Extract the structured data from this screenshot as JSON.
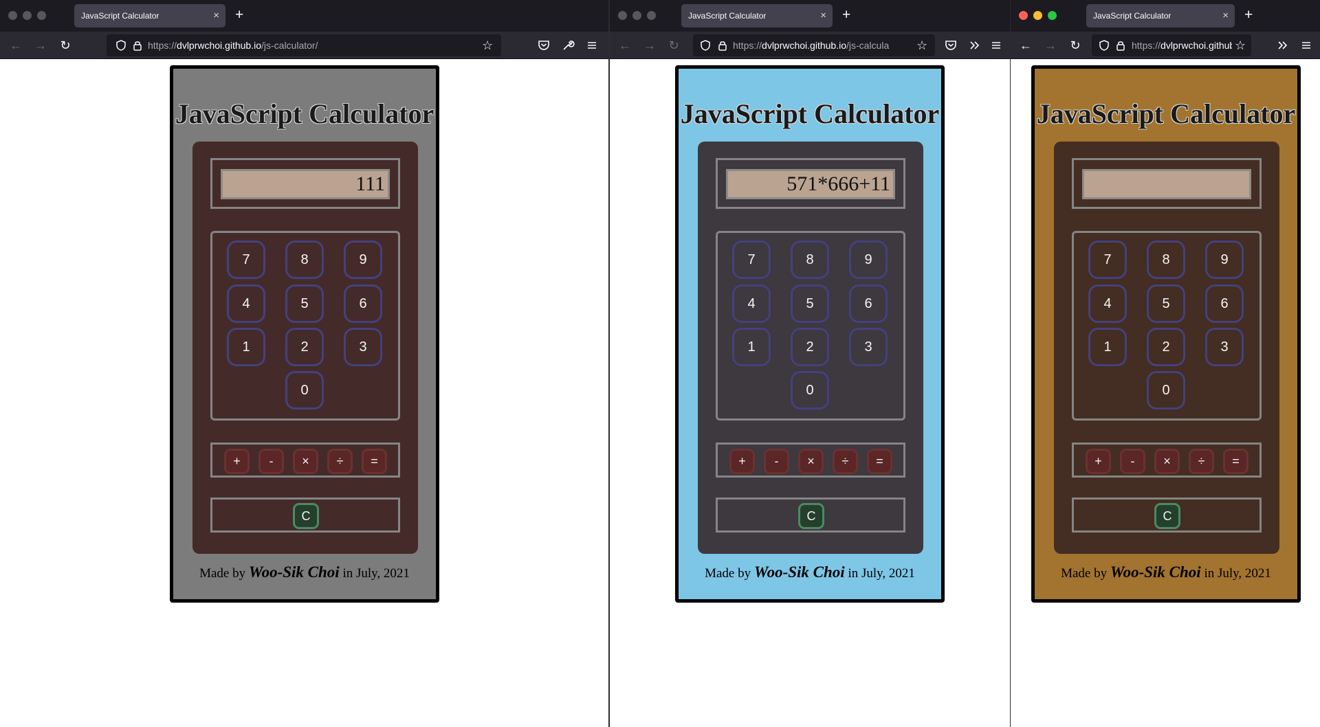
{
  "colors": {
    "titlebar": "#1c1b22",
    "toolbar": "#2b2a33",
    "keypad_border": "#43417e",
    "operator_border": "#6b3131",
    "clear_border": "#4c8a63"
  },
  "windows": [
    {
      "tab_title": "JavaScript Calculator",
      "url_prefix": "https://",
      "url_domain": "dvlprwchoi.github.io",
      "url_path": "/js-calculator/",
      "traffic_lights_active": false,
      "theme": {
        "card_bg": "#7c7c7c",
        "body_bg": "#452a2a"
      },
      "display_value": "111"
    },
    {
      "tab_title": "JavaScript Calculator",
      "url_prefix": "https://",
      "url_domain": "dvlprwchoi.github.io",
      "url_path": "/js-calcula",
      "traffic_lights_active": false,
      "theme": {
        "card_bg": "#7ec6e6",
        "body_bg": "#3e383f"
      },
      "display_value": "571*666+11"
    },
    {
      "tab_title": "JavaScript Calculator",
      "url_prefix": "https://",
      "url_domain": "dvlprwchoi.github",
      "url_path": "",
      "traffic_lights_active": true,
      "theme": {
        "card_bg": "#a3742f",
        "body_bg": "#442d22"
      },
      "display_value": ""
    }
  ],
  "calculator": {
    "title": "JavaScript Calculator",
    "digits": [
      "7",
      "8",
      "9",
      "4",
      "5",
      "6",
      "1",
      "2",
      "3",
      "0"
    ],
    "operators": [
      "+",
      "-",
      "×",
      "÷",
      "="
    ],
    "clear": "C",
    "footer": {
      "prefix": "Made by",
      "author": "Woo-Sik Choi",
      "suffix": "in July, 2021"
    }
  },
  "icons": {
    "back": "arrow-left-icon",
    "forward": "arrow-right-icon",
    "reload": "reload-icon",
    "shield": "shield-icon",
    "lock": "lock-icon",
    "bookmark": "star-icon",
    "pocket": "pocket-icon",
    "tools": "wrench-icon",
    "menu": "hamburger-menu-icon",
    "overflow": "chevron-double-right-icon"
  }
}
